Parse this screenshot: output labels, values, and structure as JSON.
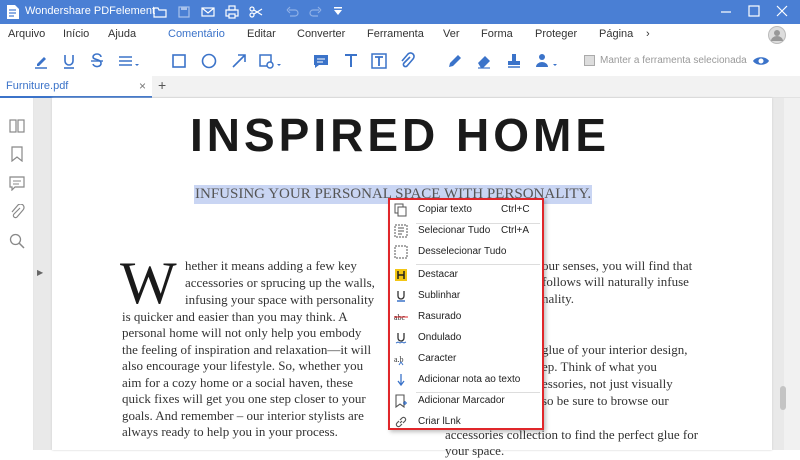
{
  "titlebar": {
    "app_title": "Wondershare PDFelement",
    "quick_access": [
      "folder-icon",
      "save-icon",
      "mail-icon",
      "print-icon",
      "scissors-icon",
      "undo-icon",
      "redo-icon",
      "customize-icon"
    ],
    "window_controls": [
      "minimize-icon",
      "maximize-icon",
      "close-icon"
    ]
  },
  "menu": {
    "items": [
      "Arquivo",
      "Início",
      "Ajuda",
      "Comentário",
      "Editar",
      "Converter",
      "Ferramenta",
      "Ver",
      "Forma",
      "Proteger",
      "Página"
    ],
    "active": "Comentário",
    "more": "›"
  },
  "toolbar": {
    "keep_tool_label": "Manter a ferramenta selecionada",
    "accent": "#3b73c9"
  },
  "tabs": {
    "active_file": "Furniture.pdf",
    "close": "×",
    "add": "+"
  },
  "document": {
    "title": "INSPIRED HOME",
    "subtitle": "INFUSING YOUR PERSONAL SPACE WITH PERSONALITY.",
    "drop_cap": "W",
    "left_column": [
      "hether it means adding a few key",
      "accessories or sprucing up the walls,",
      "infusing your space with personality",
      "is quicker and easier than you may think. A",
      "personal home will not only help you embody",
      "the feeling of inspiration and relaxation—it will",
      "also encourage your lifestyle. So, whether you",
      "aim for a cozy home or a social haven, these",
      "quick fixes will get you one step closer to your",
      "goals. And remember – our interior stylists are",
      "always ready to help you in your process."
    ],
    "right_column_top": [
      "our senses, you will find that",
      "follows will naturally infuse",
      "nality."
    ],
    "right_column_bottom": [
      "glue of your interior design,",
      "ep. Think of what you",
      "essories, not just visually",
      "so be sure to browse our",
      "accessories collection to find the perfect glue for",
      "your space."
    ]
  },
  "context_menu": {
    "border_color": "#e0262a",
    "items": [
      {
        "label": "Copiar texto",
        "shortcut": "Ctrl+C",
        "icon": "copy-icon"
      },
      {
        "label": "Selecionar Tudo",
        "shortcut": "Ctrl+A",
        "icon": "select-all-icon"
      },
      {
        "label": "Desselecionar Tudo",
        "shortcut": "",
        "icon": "deselect-all-icon"
      },
      {
        "label": "Destacar",
        "shortcut": "",
        "icon": "highlight-icon"
      },
      {
        "label": "Sublinhar",
        "shortcut": "",
        "icon": "underline-icon"
      },
      {
        "label": "Rasurado",
        "shortcut": "",
        "icon": "strikethrough-icon"
      },
      {
        "label": "Ondulado",
        "shortcut": "",
        "icon": "squiggly-icon"
      },
      {
        "label": "Caracter",
        "shortcut": "",
        "icon": "caret-icon"
      },
      {
        "label": "Adicionar nota ao texto",
        "shortcut": "",
        "icon": "text-note-icon"
      },
      {
        "label": "Adicionar Marcador",
        "shortcut": "",
        "icon": "bookmark-add-icon"
      },
      {
        "label": "Criar lLnk",
        "shortcut": "",
        "icon": "link-icon"
      }
    ]
  }
}
